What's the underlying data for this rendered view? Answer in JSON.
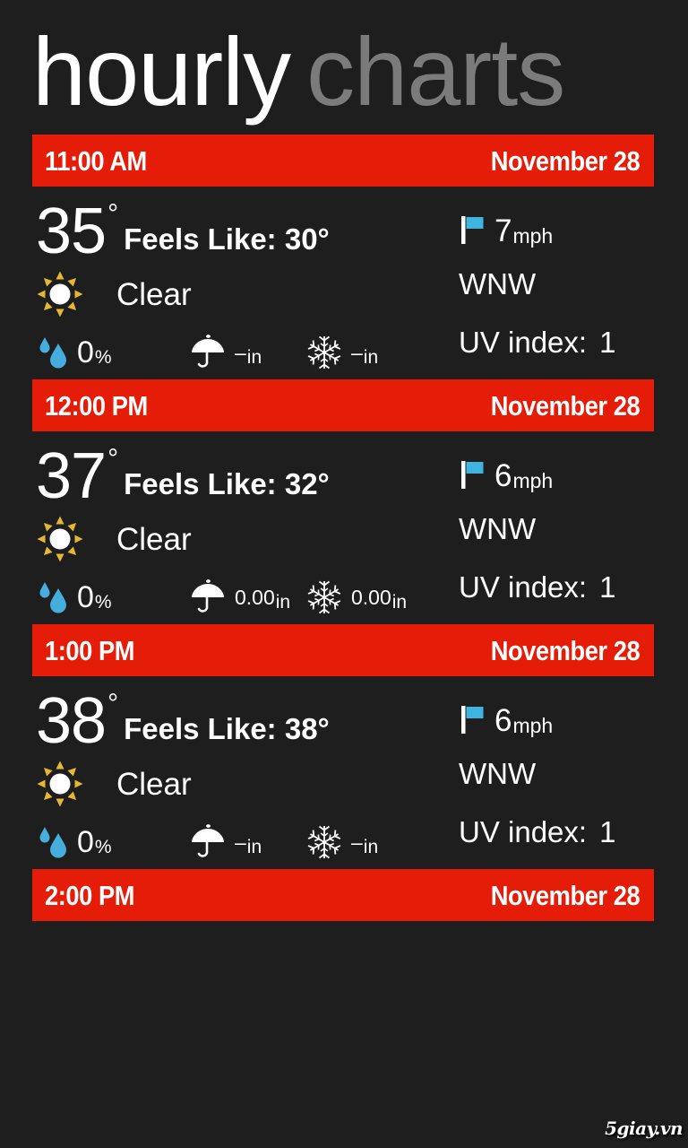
{
  "header": {
    "title_primary": "hourly",
    "title_secondary": "charts"
  },
  "colors": {
    "background": "#1e1e1e",
    "accent_red": "#e41c08",
    "title_primary": "#ffffff",
    "title_secondary": "#7b7b7b",
    "sun_ray": "#e6b831",
    "sun_core": "#ffffff",
    "raindrop_blue": "#45aedd",
    "flag_blue": "#3fb4de"
  },
  "labels": {
    "feels_like_prefix": "Feels Like: ",
    "uv_index_label": "UV index:",
    "wind_unit": "mph",
    "pop_unit": "%",
    "precip_unit": "in"
  },
  "icons": {
    "sun": "sun-icon",
    "raindrop": "raindrop-icon",
    "umbrella": "umbrella-icon",
    "snowflake": "snowflake-icon",
    "flag": "wind-flag-icon"
  },
  "hours": [
    {
      "time": "11:00 AM",
      "date": "November 28",
      "temp": "35",
      "degree": "°",
      "feels_like": "Feels Like: 30°",
      "condition": "Clear",
      "condition_icon": "sun-icon",
      "pop": "0",
      "pop_unit": "%",
      "rain": "–",
      "rain_unit": "in",
      "snow": "–",
      "snow_unit": "in",
      "wind_speed": "7",
      "wind_unit": "mph",
      "wind_dir": "WNW",
      "uv_label": "UV index:",
      "uv_value": "1"
    },
    {
      "time": "12:00 PM",
      "date": "November 28",
      "temp": "37",
      "degree": "°",
      "feels_like": "Feels Like: 32°",
      "condition": "Clear",
      "condition_icon": "sun-icon",
      "pop": "0",
      "pop_unit": "%",
      "rain": "0.00",
      "rain_unit": "in",
      "snow": "0.00",
      "snow_unit": "in",
      "wind_speed": "6",
      "wind_unit": "mph",
      "wind_dir": "WNW",
      "uv_label": "UV index:",
      "uv_value": "1"
    },
    {
      "time": "1:00 PM",
      "date": "November 28",
      "temp": "38",
      "degree": "°",
      "feels_like": "Feels Like: 38°",
      "condition": "Clear",
      "condition_icon": "sun-icon",
      "pop": "0",
      "pop_unit": "%",
      "rain": "–",
      "rain_unit": "in",
      "snow": "–",
      "snow_unit": "in",
      "wind_speed": "6",
      "wind_unit": "mph",
      "wind_dir": "WNW",
      "uv_label": "UV index:",
      "uv_value": "1"
    },
    {
      "time": "2:00 PM",
      "date": "November 28",
      "temp": "",
      "degree": "",
      "feels_like": "",
      "condition": "",
      "condition_icon": "sun-icon",
      "pop": "",
      "pop_unit": "",
      "rain": "",
      "rain_unit": "",
      "snow": "",
      "snow_unit": "",
      "wind_speed": "",
      "wind_unit": "",
      "wind_dir": "",
      "uv_label": "",
      "uv_value": ""
    }
  ],
  "watermark": "5giay.vn"
}
